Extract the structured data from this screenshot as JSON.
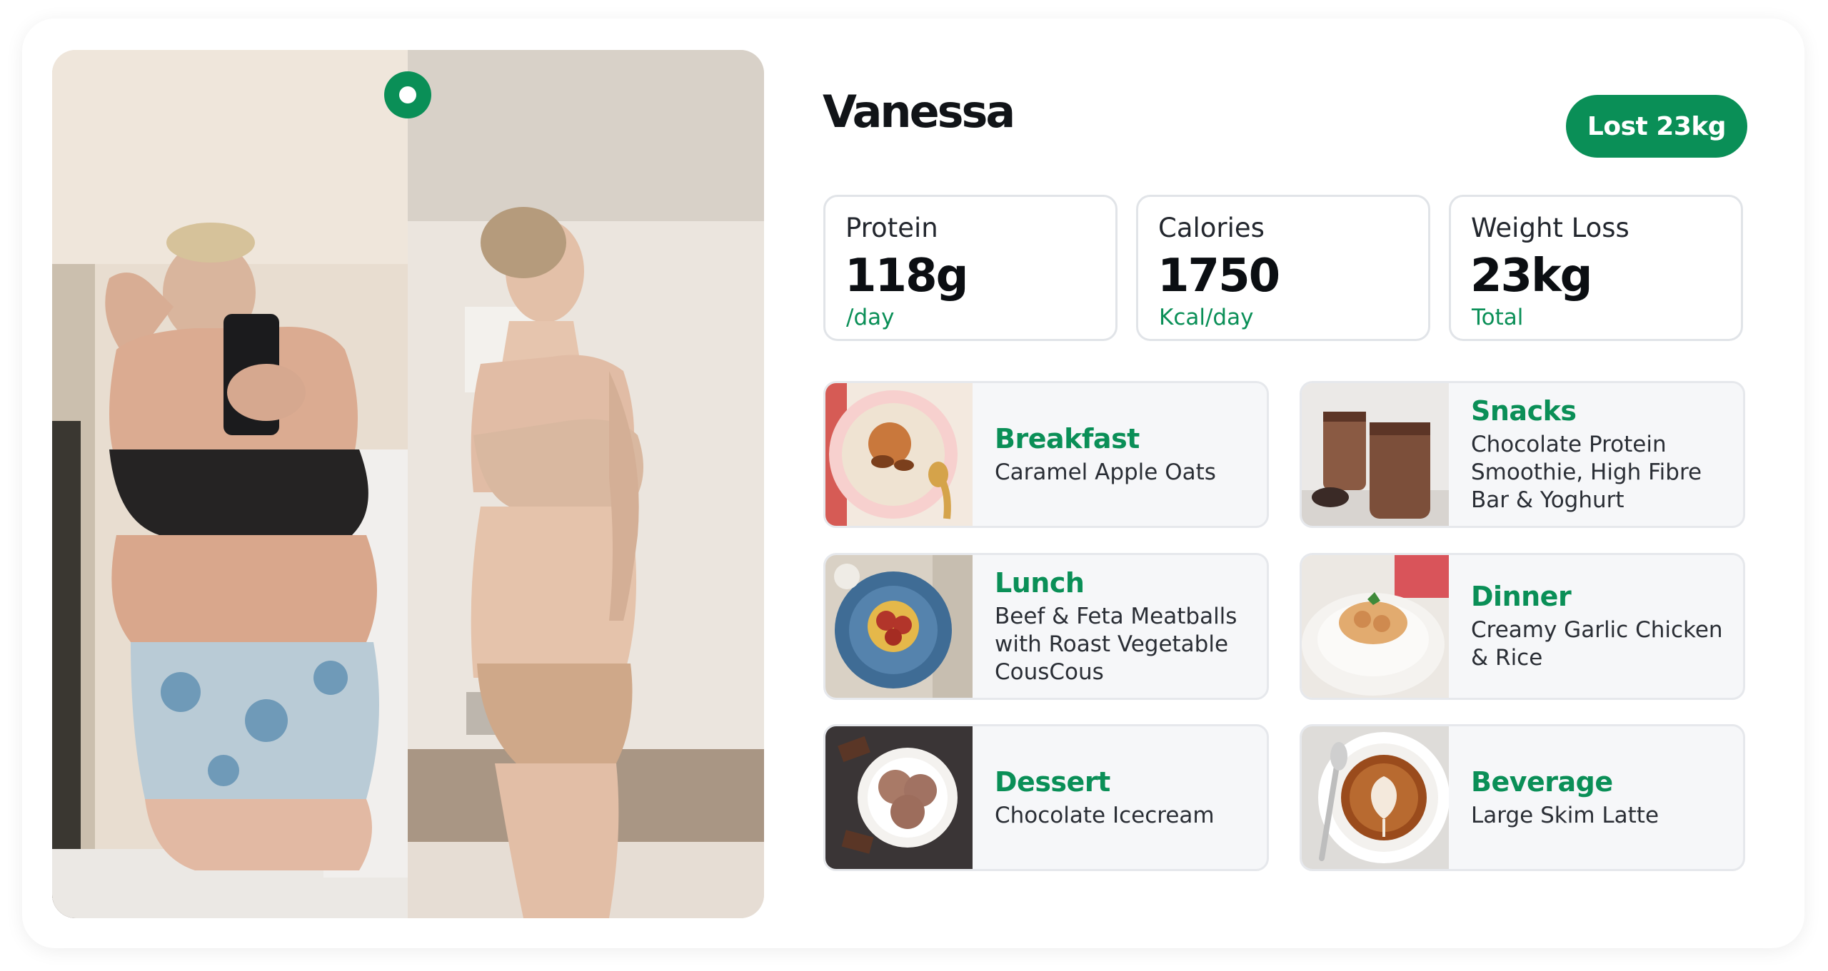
{
  "profile": {
    "name": "Vanessa",
    "badge": "Lost 23kg"
  },
  "stats": [
    {
      "label": "Protein",
      "value": "118g",
      "unit": "/day"
    },
    {
      "label": "Calories",
      "value": "1750",
      "unit": "Kcal/day"
    },
    {
      "label": "Weight Loss",
      "value": "23kg",
      "unit": "Total"
    }
  ],
  "meals": [
    {
      "category": "Breakfast",
      "description": "Caramel Apple Oats",
      "image": "caramel-apple-oats-photo"
    },
    {
      "category": "Snacks",
      "description": "Chocolate Protein\nSmoothie, High Fibre\nBar & Yoghurt",
      "image": "chocolate-smoothie-photo"
    },
    {
      "category": "Lunch",
      "description": "Beef & Feta Meatballs\nwith Roast Vegetable\nCousCous",
      "image": "meatballs-couscous-photo"
    },
    {
      "category": "Dinner",
      "description": "Creamy Garlic Chicken\n& Rice",
      "image": "garlic-chicken-rice-photo"
    },
    {
      "category": "Dessert",
      "description": "Chocolate Icecream",
      "image": "chocolate-icecream-photo"
    },
    {
      "category": "Beverage",
      "description": "Large Skim Latte",
      "image": "skim-latte-photo"
    }
  ],
  "photo": {
    "description_icon": "before-after-photo",
    "logo_icon": "ring-logo-icon"
  },
  "colors": {
    "accent": "#0a8f57",
    "card_border": "#e1e4e8",
    "meal_bg": "#f6f7f9",
    "text_dark": "#111418"
  }
}
